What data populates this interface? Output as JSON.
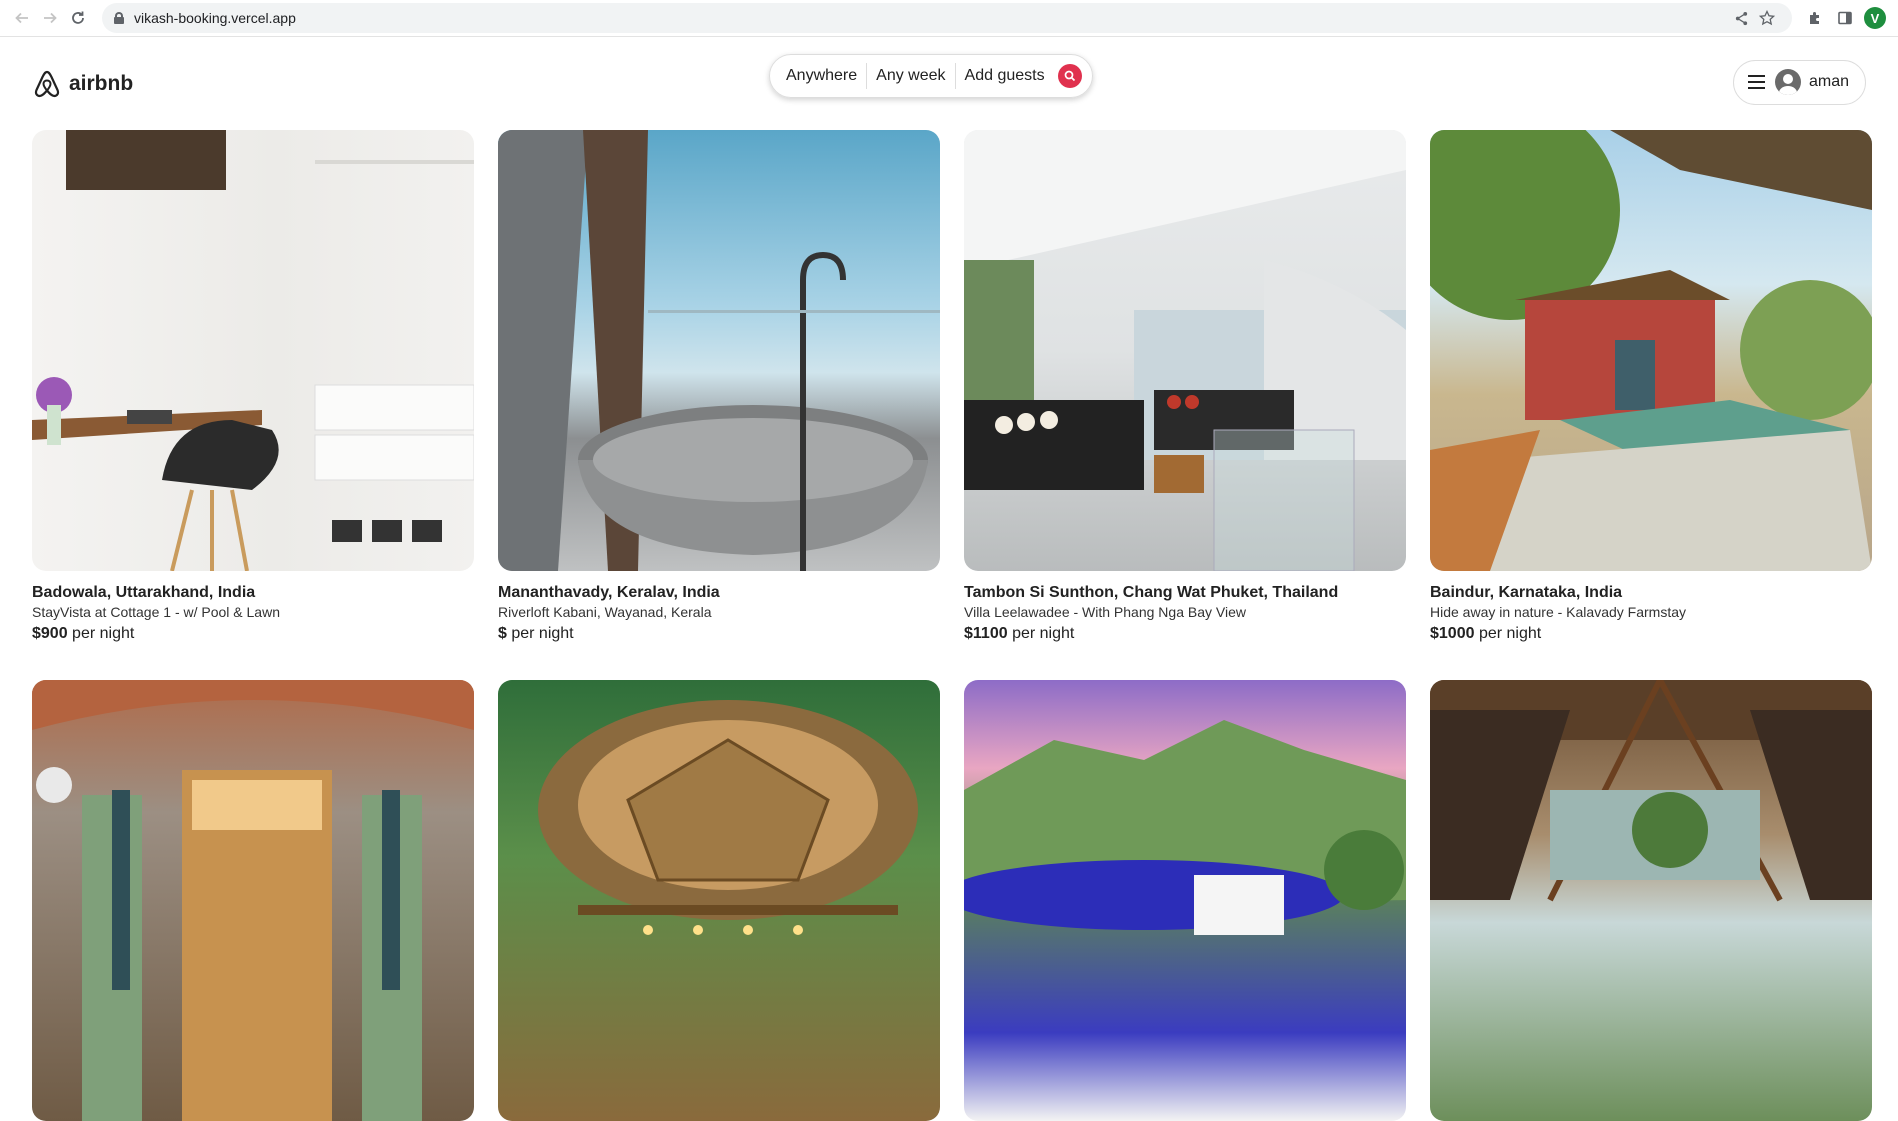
{
  "browser": {
    "url": "vikash-booking.vercel.app",
    "profile_initial": "V",
    "icons": [
      "back-arrow-icon",
      "forward-arrow-icon",
      "reload-icon",
      "lock-icon",
      "share-icon",
      "star-icon",
      "extensions-icon",
      "side-panel-icon"
    ]
  },
  "header": {
    "logo_text": "airbnb",
    "search": {
      "where": "Anywhere",
      "when": "Any week",
      "who": "Add guests"
    },
    "user": {
      "name": "aman"
    },
    "colors": {
      "brand": "#e0314e"
    }
  },
  "listings": [
    {
      "location": "Badowala, Uttarakhand, India",
      "title": "StayVista at Cottage 1 - w/ Pool & Lawn",
      "price": "$900",
      "price_suffix": "per night"
    },
    {
      "location": "Mananthavady, Keralav, India",
      "title": "Riverloft Kabani, Wayanad, Kerala",
      "price": "$",
      "price_suffix": "per night"
    },
    {
      "location": "Tambon Si Sunthon, Chang Wat Phuket, Thailand",
      "title": "Villa Leelawadee - With Phang Nga Bay View",
      "price": "$1100",
      "price_suffix": "per night"
    },
    {
      "location": "Baindur, Karnataka, India",
      "title": "Hide away in nature - Kalavady Farmstay",
      "price": "$1000",
      "price_suffix": "per night"
    }
  ]
}
